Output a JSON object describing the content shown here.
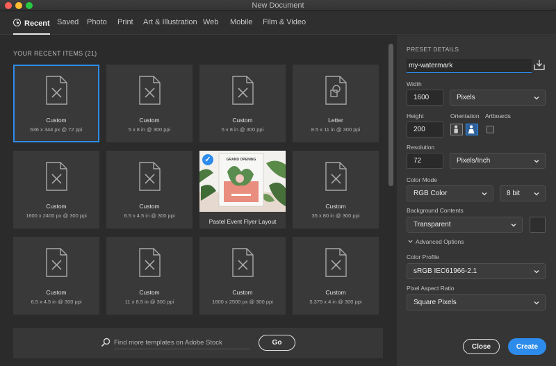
{
  "window": {
    "title": "New Document"
  },
  "tabs": [
    {
      "label": "Recent",
      "active": true
    },
    {
      "label": "Saved"
    },
    {
      "label": "Photo"
    },
    {
      "label": "Print"
    },
    {
      "label": "Art & Illustration"
    },
    {
      "label": "Web"
    },
    {
      "label": "Mobile"
    },
    {
      "label": "Film & Video"
    }
  ],
  "recent": {
    "heading": "YOUR RECENT ITEMS",
    "count": "(21)",
    "items": [
      {
        "name": "Custom",
        "dims": "636 x 344 px @ 72 ppi",
        "icon": "blank-document-icon",
        "selected": true
      },
      {
        "name": "Custom",
        "dims": "5 x 8 in @ 300 ppi",
        "icon": "blank-document-icon"
      },
      {
        "name": "Custom",
        "dims": "5 x 8 in @ 300 ppi",
        "icon": "blank-document-icon"
      },
      {
        "name": "Letter",
        "dims": "8.5 x 11 in @ 300 ppi",
        "icon": "shape-document-icon"
      },
      {
        "name": "Custom",
        "dims": "1600 x 2400 px @ 300 ppi",
        "icon": "blank-document-icon"
      },
      {
        "name": "Custom",
        "dims": "6.5 x 4.5 in @ 300 ppi",
        "icon": "blank-document-icon"
      },
      {
        "name": "Pastel Event Flyer Layout",
        "dims": "",
        "icon": "template-thumbnail",
        "thumb_text": "GRAND OPENING",
        "checked": true
      },
      {
        "name": "Custom",
        "dims": "35 x 80 in @ 300 ppi",
        "icon": "blank-document-icon"
      },
      {
        "name": "Custom",
        "dims": "6.5 x 4.5 in @ 300 ppi",
        "icon": "blank-document-icon"
      },
      {
        "name": "Custom",
        "dims": "11 x 8.5 in @ 300 ppi",
        "icon": "blank-document-icon"
      },
      {
        "name": "Custom",
        "dims": "1600 x 2500 px @ 300 ppi",
        "icon": "blank-document-icon"
      },
      {
        "name": "Custom",
        "dims": "5.375 x 4 in @ 300 ppi",
        "icon": "blank-document-icon"
      }
    ]
  },
  "stock_search": {
    "placeholder": "Find more templates on Adobe Stock",
    "go_label": "Go"
  },
  "preset": {
    "heading": "PRESET DETAILS",
    "name": "my-watermark",
    "width_label": "Width",
    "width_value": "1600",
    "width_unit": "Pixels",
    "height_label": "Height",
    "height_value": "200",
    "orientation_label": "Orientation",
    "orientation": "landscape",
    "artboards_label": "Artboards",
    "artboards_checked": false,
    "resolution_label": "Resolution",
    "resolution_value": "72",
    "resolution_unit": "Pixels/Inch",
    "color_mode_label": "Color Mode",
    "color_mode": "RGB Color",
    "bit_depth": "8 bit",
    "background_label": "Background Contents",
    "background": "Transparent",
    "advanced_label": "Advanced Options",
    "color_profile_label": "Color Profile",
    "color_profile": "sRGB IEC61966-2.1",
    "pixel_aspect_label": "Pixel Aspect Ratio",
    "pixel_aspect": "Square Pixels"
  },
  "actions": {
    "close_label": "Close",
    "create_label": "Create"
  },
  "colors": {
    "accent": "#2d8ceb",
    "panel": "#353535",
    "card": "#393939",
    "background": "#2b2b2b"
  }
}
